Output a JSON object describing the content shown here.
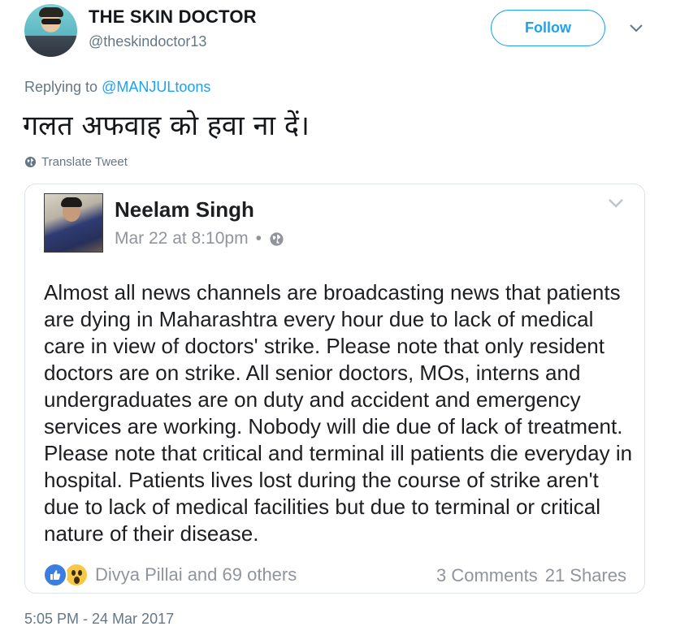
{
  "header": {
    "display_name": "THE SKIN DOCTOR",
    "handle": "@theskindoctor13",
    "follow_label": "Follow"
  },
  "reply": {
    "prefix": "Replying to",
    "mention": "@MANJULtoons"
  },
  "tweet": {
    "text": "गलत अफवाह को हवा ना दें।",
    "translate_label": "Translate Tweet",
    "timestamp": "5:05 PM - 24 Mar 2017"
  },
  "card": {
    "name": "Neelam Singh",
    "date": "Mar 22 at 8:10pm",
    "separator": "•",
    "body": "Almost all news channels are broadcasting news that patients are dying in Maharashtra every hour due to lack of medical care in view of doctors' strike. Please note that only resident doctors are on strike. All senior doctors, MOs, interns and undergraduates are on duty and accident and emergency services are working. Nobody will die due of lack of treatment. Please note that critical and terminal ill patients die everyday in hospital. Patients lives lost during the course of strike aren't due to lack of medical facilities but due to terminal or critical nature of their disease.",
    "reactions_text": "Divya Pillai and 69 others",
    "comments": "3 Comments",
    "shares": "21 Shares"
  },
  "colors": {
    "accent": "#1da1f2",
    "muted": "#657786",
    "like_blue": "#3b7de0",
    "wow_yellow": "#f7c844"
  },
  "icons": [
    "caret-down-icon",
    "globe-icon",
    "like-reaction-icon",
    "wow-reaction-icon"
  ]
}
